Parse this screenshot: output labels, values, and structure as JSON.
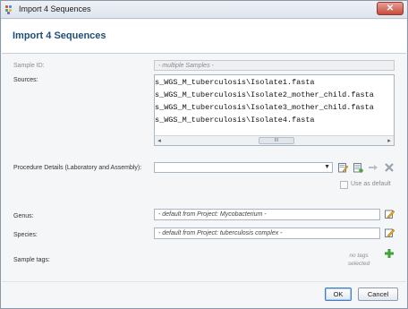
{
  "window": {
    "title": "Import 4 Sequences",
    "close_symbol": "✕"
  },
  "header": {
    "title": "Import 4 Sequences"
  },
  "sample_id": {
    "label": "Sample ID:",
    "value": "- multiple Samples -"
  },
  "sources": {
    "label": "Sources:",
    "lines": [
      "s_WGS_M_tuberculosis\\Isolate1.fasta",
      "s_WGS_M_tuberculosis\\Isolate2_mother_child.fasta",
      "s_WGS_M_tuberculosis\\Isolate3_mother_child.fasta",
      "s_WGS_M_tuberculosis\\Isolate4.fasta"
    ]
  },
  "procedure": {
    "label": "Procedure Details (Laboratory and Assembly):",
    "value": "",
    "use_as_default_label": "Use as default",
    "use_as_default_checked": false
  },
  "genus": {
    "label": "Genus:",
    "value": "- default from Project: Mycobacterium -"
  },
  "species": {
    "label": "Species:",
    "value": "- default from Project: tuberculosis complex -"
  },
  "sample_tags": {
    "label": "Sample tags:",
    "empty_text_line1": "no tags",
    "empty_text_line2": "selected"
  },
  "buttons": {
    "ok": "OK",
    "cancel": "Cancel"
  },
  "colors": {
    "accent": "#1f4e79",
    "close": "#c74a3a"
  }
}
